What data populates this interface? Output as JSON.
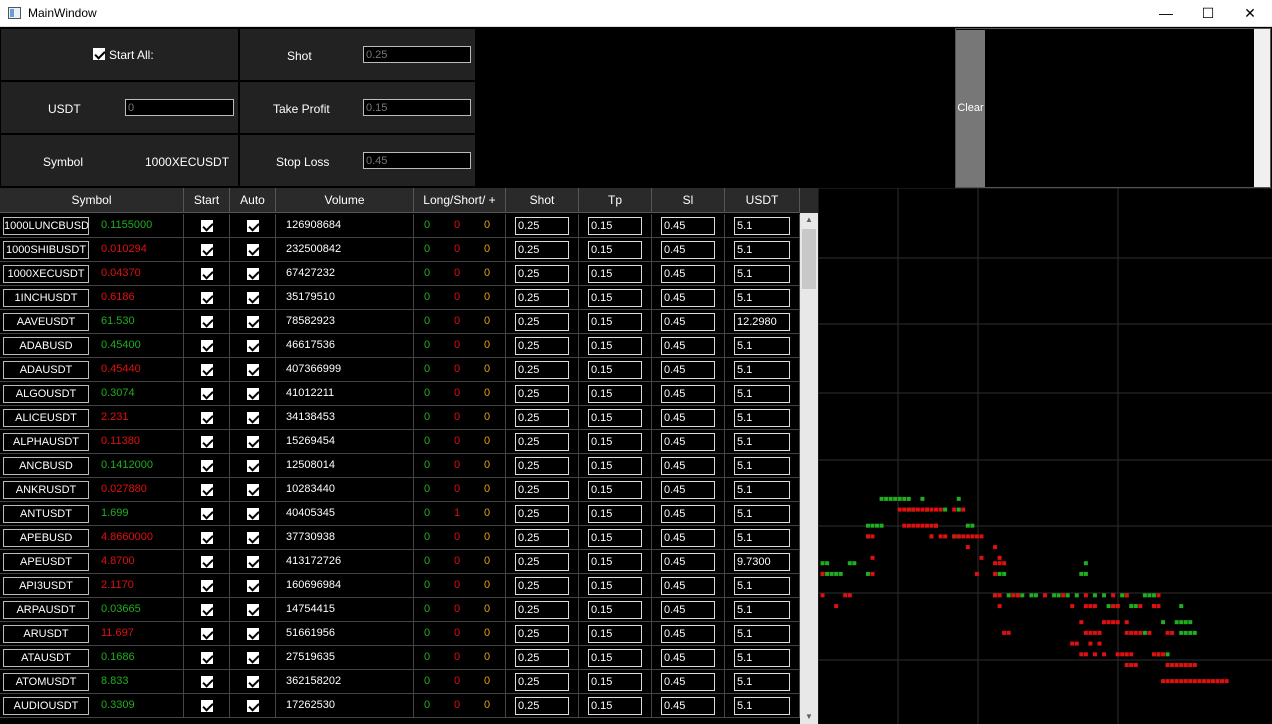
{
  "window": {
    "title": "MainWindow",
    "minimize": "—",
    "maximize": "☐",
    "close": "✕"
  },
  "controls": {
    "start_all_label": "Start All:",
    "start_all_checked": true,
    "shot_label": "Shot",
    "shot_value": "0.25",
    "usdt_label": "USDT",
    "usdt_value": "0",
    "take_profit_label": "Take Profit",
    "take_profit_value": "0.15",
    "symbol_label": "Symbol",
    "symbol_value": "1000XECUSDT",
    "stop_loss_label": "Stop Loss",
    "stop_loss_value": "0.45",
    "clear_label": "Clear"
  },
  "table": {
    "headers": [
      "Symbol",
      "Start",
      "Auto",
      "Volume",
      "Long/Short/ +",
      "Shot",
      "Tp",
      "Sl",
      "USDT"
    ],
    "rows": [
      {
        "symbol": "1000LUNCBUSD",
        "price": "0.1155000",
        "color": "#1fae1f",
        "volume": "126908684",
        "long": "0",
        "short": "0",
        "plus": "0",
        "shot": "0.25",
        "tp": "0.15",
        "sl": "0.45",
        "usdt": "5.1"
      },
      {
        "symbol": "1000SHIBUSDT",
        "price": "0.010294",
        "color": "#e01010",
        "volume": "232500842",
        "long": "0",
        "short": "0",
        "plus": "0",
        "shot": "0.25",
        "tp": "0.15",
        "sl": "0.45",
        "usdt": "5.1"
      },
      {
        "symbol": "1000XECUSDT",
        "price": "0.04370",
        "color": "#e01010",
        "volume": "67427232",
        "long": "0",
        "short": "0",
        "plus": "0",
        "shot": "0.25",
        "tp": "0.15",
        "sl": "0.45",
        "usdt": "5.1"
      },
      {
        "symbol": "1INCHUSDT",
        "price": "0.6186",
        "color": "#e01010",
        "volume": "35179510",
        "long": "0",
        "short": "0",
        "plus": "0",
        "shot": "0.25",
        "tp": "0.15",
        "sl": "0.45",
        "usdt": "5.1"
      },
      {
        "symbol": "AAVEUSDT",
        "price": "61.530",
        "color": "#1fae1f",
        "volume": "78582923",
        "long": "0",
        "short": "0",
        "plus": "0",
        "shot": "0.25",
        "tp": "0.15",
        "sl": "0.45",
        "usdt": "12.2980"
      },
      {
        "symbol": "ADABUSD",
        "price": "0.45400",
        "color": "#1fae1f",
        "volume": "46617536",
        "long": "0",
        "short": "0",
        "plus": "0",
        "shot": "0.25",
        "tp": "0.15",
        "sl": "0.45",
        "usdt": "5.1"
      },
      {
        "symbol": "ADAUSDT",
        "price": "0.45440",
        "color": "#e01010",
        "volume": "407366999",
        "long": "0",
        "short": "0",
        "plus": "0",
        "shot": "0.25",
        "tp": "0.15",
        "sl": "0.45",
        "usdt": "5.1"
      },
      {
        "symbol": "ALGOUSDT",
        "price": "0.3074",
        "color": "#1fae1f",
        "volume": "41012211",
        "long": "0",
        "short": "0",
        "plus": "0",
        "shot": "0.25",
        "tp": "0.15",
        "sl": "0.45",
        "usdt": "5.1"
      },
      {
        "symbol": "ALICEUSDT",
        "price": "2.231",
        "color": "#e01010",
        "volume": "34138453",
        "long": "0",
        "short": "0",
        "plus": "0",
        "shot": "0.25",
        "tp": "0.15",
        "sl": "0.45",
        "usdt": "5.1"
      },
      {
        "symbol": "ALPHAUSDT",
        "price": "0.11380",
        "color": "#e01010",
        "volume": "15269454",
        "long": "0",
        "short": "0",
        "plus": "0",
        "shot": "0.25",
        "tp": "0.15",
        "sl": "0.45",
        "usdt": "5.1"
      },
      {
        "symbol": "ANCBUSD",
        "price": "0.1412000",
        "color": "#1fae1f",
        "volume": "12508014",
        "long": "0",
        "short": "0",
        "plus": "0",
        "shot": "0.25",
        "tp": "0.15",
        "sl": "0.45",
        "usdt": "5.1"
      },
      {
        "symbol": "ANKRUSDT",
        "price": "0.027880",
        "color": "#e01010",
        "volume": "10283440",
        "long": "0",
        "short": "0",
        "plus": "0",
        "shot": "0.25",
        "tp": "0.15",
        "sl": "0.45",
        "usdt": "5.1"
      },
      {
        "symbol": "ANTUSDT",
        "price": "1.699",
        "color": "#1fae1f",
        "volume": "40405345",
        "long": "0",
        "short": "1",
        "plus": "0",
        "shot": "0.25",
        "tp": "0.15",
        "sl": "0.45",
        "usdt": "5.1"
      },
      {
        "symbol": "APEBUSD",
        "price": "4.8660000",
        "color": "#e01010",
        "volume": "37730938",
        "long": "0",
        "short": "0",
        "plus": "0",
        "shot": "0.25",
        "tp": "0.15",
        "sl": "0.45",
        "usdt": "5.1"
      },
      {
        "symbol": "APEUSDT",
        "price": "4.8700",
        "color": "#e01010",
        "volume": "413172726",
        "long": "0",
        "short": "0",
        "plus": "0",
        "shot": "0.25",
        "tp": "0.15",
        "sl": "0.45",
        "usdt": "9.7300"
      },
      {
        "symbol": "API3USDT",
        "price": "2.1170",
        "color": "#e01010",
        "volume": "160696984",
        "long": "0",
        "short": "0",
        "plus": "0",
        "shot": "0.25",
        "tp": "0.15",
        "sl": "0.45",
        "usdt": "5.1"
      },
      {
        "symbol": "ARPAUSDT",
        "price": "0.03665",
        "color": "#1fae1f",
        "volume": "14754415",
        "long": "0",
        "short": "0",
        "plus": "0",
        "shot": "0.25",
        "tp": "0.15",
        "sl": "0.45",
        "usdt": "5.1"
      },
      {
        "symbol": "ARUSDT",
        "price": "11.697",
        "color": "#e01010",
        "volume": "51661956",
        "long": "0",
        "short": "0",
        "plus": "0",
        "shot": "0.25",
        "tp": "0.15",
        "sl": "0.45",
        "usdt": "5.1"
      },
      {
        "symbol": "ATAUSDT",
        "price": "0.1686",
        "color": "#1fae1f",
        "volume": "27519635",
        "long": "0",
        "short": "0",
        "plus": "0",
        "shot": "0.25",
        "tp": "0.15",
        "sl": "0.45",
        "usdt": "5.1"
      },
      {
        "symbol": "ATOMUSDT",
        "price": "8.833",
        "color": "#1fae1f",
        "volume": "362158202",
        "long": "0",
        "short": "0",
        "plus": "0",
        "shot": "0.25",
        "tp": "0.15",
        "sl": "0.45",
        "usdt": "5.1"
      },
      {
        "symbol": "AUDIOUSDT",
        "price": "0.3309",
        "color": "#1fae1f",
        "volume": "17262530",
        "long": "0",
        "short": "0",
        "plus": "0",
        "shot": "0.25",
        "tp": "0.15",
        "sl": "0.45",
        "usdt": "5.1"
      }
    ]
  },
  "colors": {
    "up": "#1fae1f",
    "down": "#e01010",
    "grid": "#2e2e2e"
  },
  "chart_data": {
    "type": "scatter",
    "title": "",
    "xlabel": "",
    "ylabel": "",
    "grid": true,
    "xlim": [
      0,
      100
    ],
    "ylim": [
      0,
      100
    ],
    "series": [
      {
        "color": "#1fae1f",
        "points": [
          [
            14,
            42
          ],
          [
            15,
            42
          ],
          [
            16,
            42
          ],
          [
            17,
            42
          ],
          [
            18,
            42
          ],
          [
            19,
            42
          ],
          [
            20,
            42
          ],
          [
            23,
            42
          ],
          [
            31,
            42
          ],
          [
            20,
            40
          ],
          [
            21,
            40
          ],
          [
            24,
            40
          ],
          [
            28,
            40
          ],
          [
            31,
            40
          ],
          [
            11,
            37
          ],
          [
            12,
            37
          ],
          [
            13,
            37
          ],
          [
            14,
            37
          ],
          [
            26,
            37
          ],
          [
            33,
            37
          ],
          [
            34,
            37
          ],
          [
            11,
            35
          ],
          [
            25,
            35
          ],
          [
            30,
            35
          ],
          [
            31,
            35
          ],
          [
            1,
            30
          ],
          [
            2,
            30
          ],
          [
            7,
            30
          ],
          [
            8,
            30
          ],
          [
            1,
            28
          ],
          [
            2,
            28
          ],
          [
            3,
            28
          ],
          [
            4,
            28
          ],
          [
            5,
            28
          ],
          [
            11,
            28
          ],
          [
            40,
            28
          ],
          [
            41,
            28
          ],
          [
            58,
            28
          ],
          [
            59,
            30
          ],
          [
            59,
            28
          ],
          [
            39,
            24
          ],
          [
            42,
            24
          ],
          [
            44,
            24
          ],
          [
            45,
            24
          ],
          [
            47,
            24
          ],
          [
            48,
            24
          ],
          [
            52,
            24
          ],
          [
            53,
            24
          ],
          [
            55,
            24
          ],
          [
            57,
            24
          ],
          [
            61,
            24
          ],
          [
            63,
            24
          ],
          [
            67,
            24
          ],
          [
            68,
            24
          ],
          [
            72,
            24
          ],
          [
            73,
            24
          ],
          [
            74,
            24
          ],
          [
            64,
            22
          ],
          [
            66,
            22
          ],
          [
            69,
            22
          ],
          [
            70,
            22
          ],
          [
            74,
            22
          ],
          [
            80,
            22
          ],
          [
            76,
            19
          ],
          [
            79,
            19
          ],
          [
            80,
            19
          ],
          [
            81,
            19
          ],
          [
            82,
            19
          ],
          [
            72,
            17
          ],
          [
            80,
            17
          ],
          [
            81,
            17
          ],
          [
            82,
            17
          ],
          [
            83,
            17
          ],
          [
            75,
            13
          ],
          [
            77,
            13
          ]
        ]
      },
      {
        "color": "#e01010",
        "points": [
          [
            18,
            40
          ],
          [
            19,
            40
          ],
          [
            20,
            40
          ],
          [
            21,
            40
          ],
          [
            22,
            40
          ],
          [
            23,
            40
          ],
          [
            24,
            40
          ],
          [
            25,
            40
          ],
          [
            26,
            40
          ],
          [
            27,
            40
          ],
          [
            30,
            40
          ],
          [
            32,
            40
          ],
          [
            19,
            37
          ],
          [
            20,
            37
          ],
          [
            21,
            37
          ],
          [
            22,
            37
          ],
          [
            23,
            37
          ],
          [
            24,
            37
          ],
          [
            25,
            37
          ],
          [
            26,
            37
          ],
          [
            11,
            35
          ],
          [
            12,
            35
          ],
          [
            25,
            35
          ],
          [
            27,
            35
          ],
          [
            28,
            35
          ],
          [
            30,
            35
          ],
          [
            31,
            35
          ],
          [
            32,
            35
          ],
          [
            33,
            35
          ],
          [
            34,
            35
          ],
          [
            35,
            35
          ],
          [
            36,
            35
          ],
          [
            12,
            31
          ],
          [
            33,
            33
          ],
          [
            39,
            33
          ],
          [
            40,
            31
          ],
          [
            36,
            31
          ],
          [
            39,
            30
          ],
          [
            40,
            30
          ],
          [
            41,
            30
          ],
          [
            1,
            28
          ],
          [
            12,
            28
          ],
          [
            35,
            28
          ],
          [
            39,
            28
          ],
          [
            1,
            24
          ],
          [
            6,
            24
          ],
          [
            7,
            24
          ],
          [
            39,
            24
          ],
          [
            40,
            24
          ],
          [
            43,
            24
          ],
          [
            44,
            24
          ],
          [
            50,
            24
          ],
          [
            54,
            24
          ],
          [
            59,
            24
          ],
          [
            65,
            24
          ],
          [
            68,
            24
          ],
          [
            75,
            24
          ],
          [
            4,
            22
          ],
          [
            40,
            22
          ],
          [
            56,
            22
          ],
          [
            59,
            22
          ],
          [
            60,
            22
          ],
          [
            61,
            22
          ],
          [
            65,
            22
          ],
          [
            66,
            22
          ],
          [
            71,
            22
          ],
          [
            74,
            22
          ],
          [
            75,
            22
          ],
          [
            41,
            17
          ],
          [
            42,
            17
          ],
          [
            58,
            19
          ],
          [
            59,
            17
          ],
          [
            60,
            17
          ],
          [
            61,
            17
          ],
          [
            62,
            17
          ],
          [
            68,
            19
          ],
          [
            69,
            17
          ],
          [
            70,
            17
          ],
          [
            63,
            19
          ],
          [
            64,
            19
          ],
          [
            65,
            19
          ],
          [
            66,
            19
          ],
          [
            68,
            17
          ],
          [
            71,
            17
          ],
          [
            73,
            17
          ],
          [
            77,
            17
          ],
          [
            78,
            17
          ],
          [
            56,
            15
          ],
          [
            57,
            15
          ],
          [
            58,
            13
          ],
          [
            59,
            13
          ],
          [
            60,
            15
          ],
          [
            62,
            15
          ],
          [
            61,
            13
          ],
          [
            63,
            13
          ],
          [
            66,
            13
          ],
          [
            67,
            13
          ],
          [
            68,
            13
          ],
          [
            69,
            13
          ],
          [
            74,
            13
          ],
          [
            75,
            13
          ],
          [
            76,
            13
          ],
          [
            68,
            11
          ],
          [
            69,
            11
          ],
          [
            70,
            11
          ],
          [
            77,
            11
          ],
          [
            78,
            11
          ],
          [
            79,
            11
          ],
          [
            80,
            11
          ],
          [
            81,
            11
          ],
          [
            82,
            11
          ],
          [
            83,
            11
          ],
          [
            76,
            8
          ],
          [
            77,
            8
          ],
          [
            78,
            8
          ],
          [
            79,
            8
          ],
          [
            80,
            8
          ],
          [
            81,
            8
          ],
          [
            82,
            8
          ],
          [
            83,
            8
          ],
          [
            84,
            8
          ],
          [
            85,
            8
          ],
          [
            86,
            8
          ],
          [
            87,
            8
          ],
          [
            88,
            8
          ],
          [
            89,
            8
          ],
          [
            90,
            8
          ]
        ]
      }
    ]
  }
}
